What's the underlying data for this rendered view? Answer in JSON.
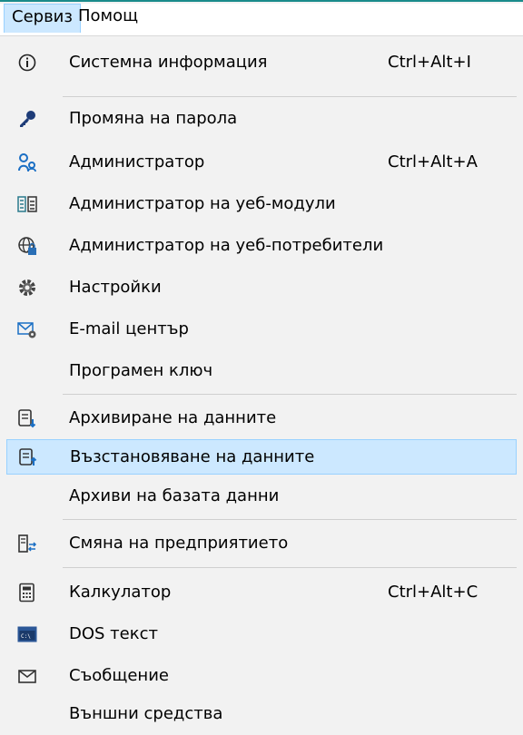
{
  "menubar": {
    "items": [
      {
        "label": "Сервиз"
      },
      {
        "label": "Помощ"
      }
    ]
  },
  "menu": {
    "items": [
      {
        "label": "Системна информация",
        "shortcut": "Ctrl+Alt+I",
        "icon": "info-icon"
      },
      {
        "label": "Промяна на парола",
        "shortcut": "",
        "icon": "key-icon"
      },
      {
        "label": "Администратор",
        "shortcut": "Ctrl+Alt+A",
        "icon": "admin-users-icon"
      },
      {
        "label": "Администратор на уеб-модули",
        "shortcut": "",
        "icon": "web-modules-icon"
      },
      {
        "label": "Администратор на уеб-потребители",
        "shortcut": "",
        "icon": "globe-lock-icon"
      },
      {
        "label": "Настройки",
        "shortcut": "",
        "icon": "gear-icon"
      },
      {
        "label": "E-mail център",
        "shortcut": "",
        "icon": "email-gear-icon"
      },
      {
        "label": "Програмен ключ",
        "shortcut": "",
        "icon": ""
      },
      {
        "label": "Архивиране на данните",
        "shortcut": "",
        "icon": "archive-down-icon"
      },
      {
        "label": "Възстановяване на данните",
        "shortcut": "",
        "icon": "restore-up-icon"
      },
      {
        "label": "Архиви на базата данни",
        "shortcut": "",
        "icon": ""
      },
      {
        "label": "Смяна на предприятието",
        "shortcut": "",
        "icon": "switch-company-icon"
      },
      {
        "label": "Калкулатор",
        "shortcut": "Ctrl+Alt+C",
        "icon": "calculator-icon"
      },
      {
        "label": "DOS текст",
        "shortcut": "",
        "icon": "dos-window-icon"
      },
      {
        "label": "Съобщение",
        "shortcut": "",
        "icon": "envelope-icon"
      },
      {
        "label": "Външни средства",
        "shortcut": "",
        "icon": ""
      }
    ]
  },
  "colors": {
    "highlight": "#cce8ff",
    "highlight_border": "#99d1ff",
    "accent_line": "#1a8b8b"
  }
}
